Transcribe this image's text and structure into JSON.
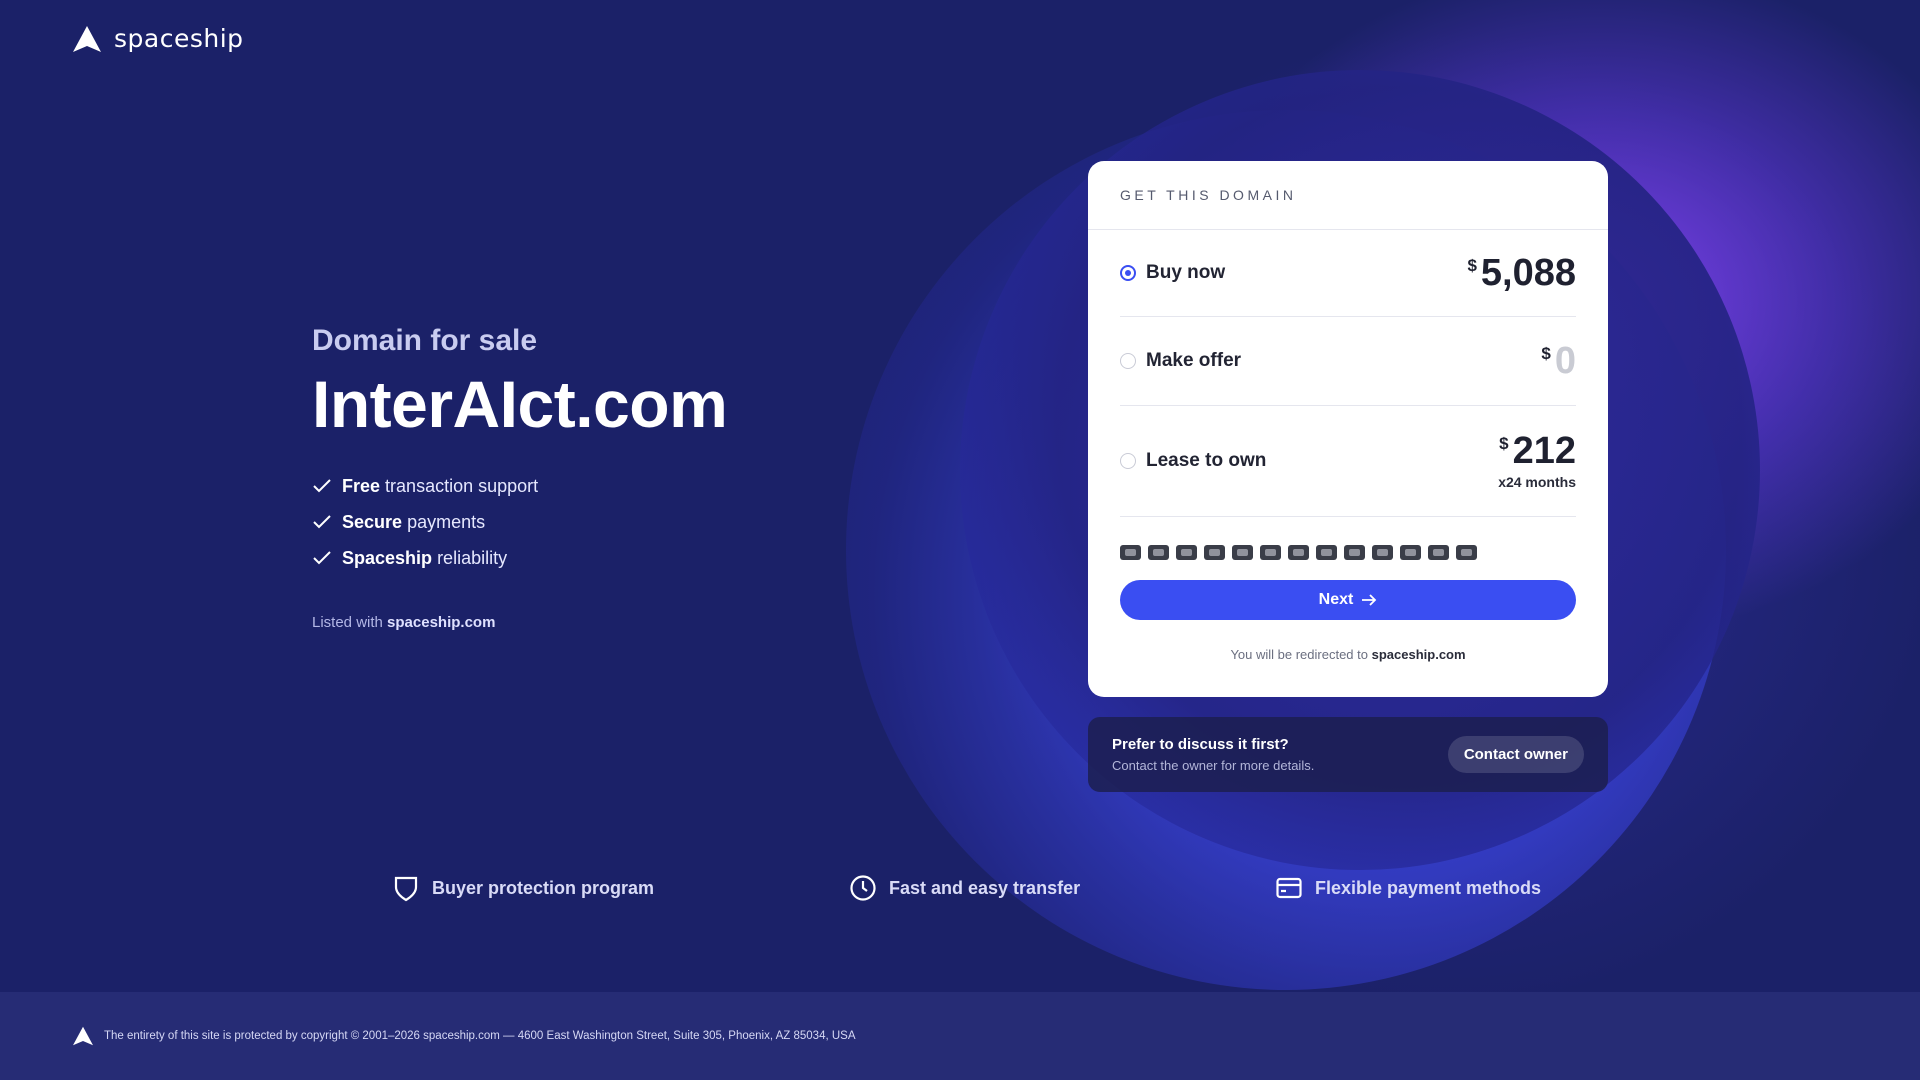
{
  "brand": {
    "name": "spaceship"
  },
  "hero": {
    "subtitle": "Domain for sale",
    "domain": "InterAIct.com",
    "features": [
      {
        "bold": "Free",
        "text": "transaction support"
      },
      {
        "bold": "Secure",
        "text": "payments"
      },
      {
        "bold": "Spaceship",
        "text": "reliability"
      }
    ],
    "listed_prefix": "Listed with",
    "listed_site": "spaceship.com"
  },
  "card": {
    "header": "GET THIS DOMAIN",
    "options": [
      {
        "label": "Buy now",
        "currency": "$",
        "amount": "5,088",
        "selected": true
      },
      {
        "label": "Make offer",
        "currency": "$",
        "amount": "0",
        "selected": false
      },
      {
        "label": "Lease to own",
        "currency": "$",
        "amount": "212",
        "term": "x24 months",
        "selected": false
      }
    ],
    "payment_icons": [
      "visa-icon",
      "mastercard-icon",
      "amex-icon",
      "discover-icon",
      "diners-icon",
      "jcb-icon",
      "unionpay-icon",
      "bitcoin-icon",
      "paypal-icon",
      "google-pay-icon",
      "apple-pay-icon",
      "alipay-icon",
      "bank-transfer-icon"
    ],
    "next_label": "Next",
    "redirect_prefix": "You will be redirected to",
    "redirect_site": "spaceship.com"
  },
  "discuss": {
    "title": "Prefer to discuss it first?",
    "subtitle": "Contact the owner for more details.",
    "button": "Contact owner"
  },
  "perks": [
    {
      "icon": "shield-icon",
      "label": "Buyer protection program"
    },
    {
      "icon": "clock-icon",
      "label": "Fast and easy transfer"
    },
    {
      "icon": "card-icon",
      "label": "Flexible payment methods"
    }
  ],
  "footer": {
    "text": "The entirety of this site is protected by copyright © 2001–2026 spaceship.com — 4600 East Washington Street, Suite 305, Phoenix, AZ 85034, USA"
  },
  "colors": {
    "accent": "#3a4ef2",
    "background": "#1b2168",
    "glow": "#8c46ff"
  }
}
